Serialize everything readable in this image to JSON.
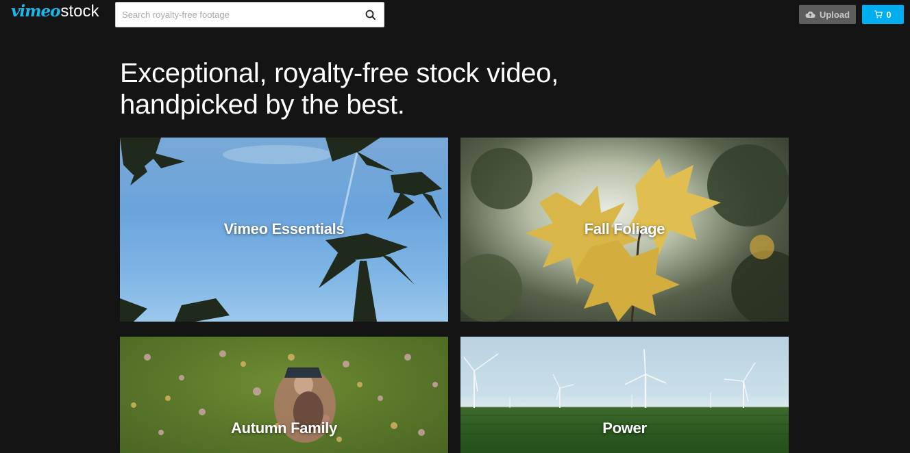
{
  "header": {
    "logo": {
      "vimeo": "vimeo",
      "stock": "stock"
    },
    "search": {
      "placeholder": "Search royalty-free footage",
      "value": "",
      "icon": "search-icon"
    },
    "upload_label": "Upload",
    "upload_icon": "cloud-upload-icon",
    "cart_count": "0",
    "cart_icon": "cart-icon",
    "accent_color": "#00adef",
    "brand_color": "#1ab7ea"
  },
  "hero": {
    "headline_line1": "Exceptional, royalty-free stock video,",
    "headline_line2": "handpicked by the best."
  },
  "collections": [
    {
      "label": "Vimeo Essentials",
      "image": "palm-trees-sky"
    },
    {
      "label": "Fall Foliage",
      "image": "autumn-maple-leaves"
    },
    {
      "label": "Autumn Family",
      "image": "child-in-fallen-leaves"
    },
    {
      "label": "Power",
      "image": "wind-turbines-field"
    }
  ]
}
